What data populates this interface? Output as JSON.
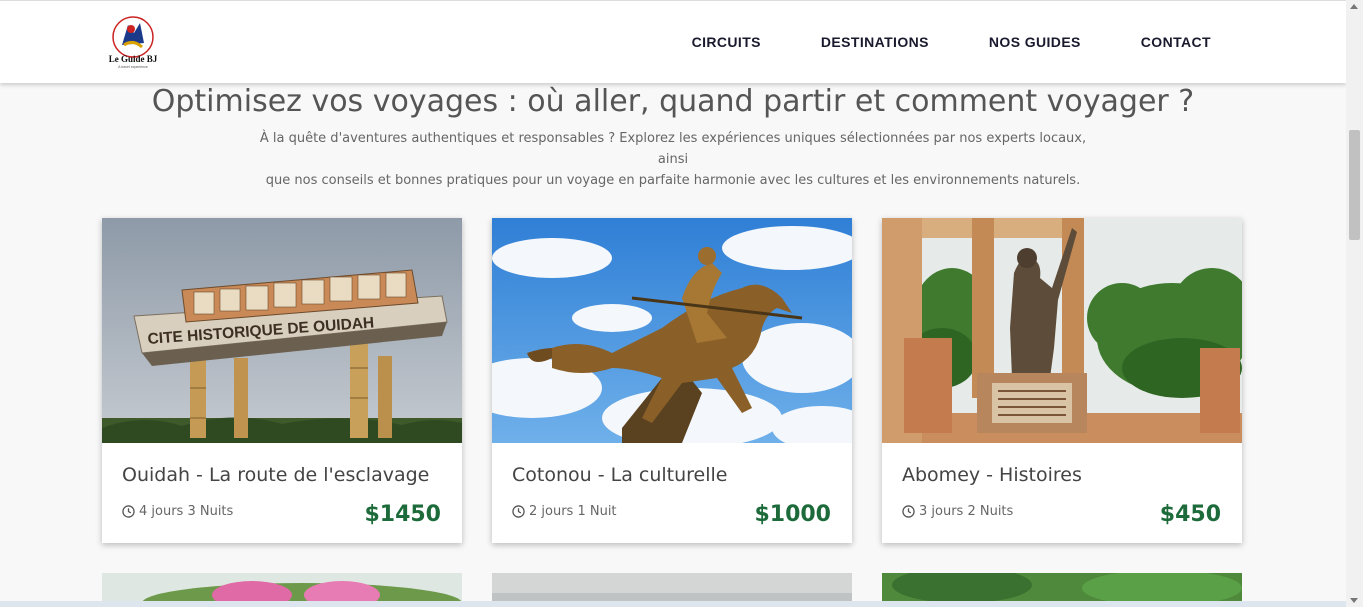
{
  "header": {
    "logo_text": "Le Guide BJ",
    "logo_tagline": "A travel experience",
    "nav": [
      "CIRCUITS",
      "DESTINATIONS",
      "NOS GUIDES",
      "CONTACT"
    ]
  },
  "intro": {
    "title": "Optimisez vos voyages : où aller, quand partir et comment voyager ?",
    "line1": "À la quête d'aventures authentiques et responsables ? Explorez les expériences uniques sélectionnées par nos experts locaux, ainsi",
    "line2": "que nos conseils et bonnes pratiques pour un voyage en parfaite harmonie avec les cultures et les environnements naturels."
  },
  "cards": [
    {
      "title": "Ouidah - La route de l'esclavage",
      "duration": "4 jours 3 Nuits",
      "price": "$1450",
      "sign": "CITE HISTORIQUE DE OUIDAH"
    },
    {
      "title": "Cotonou - La culturelle",
      "duration": "2 jours 1 Nuit",
      "price": "$1000"
    },
    {
      "title": "Abomey - Histoires",
      "duration": "3 jours 2 Nuits",
      "price": "$450"
    }
  ],
  "colors": {
    "price": "#1d6b3a",
    "nav": "#1a1a2e",
    "title": "#555555"
  }
}
